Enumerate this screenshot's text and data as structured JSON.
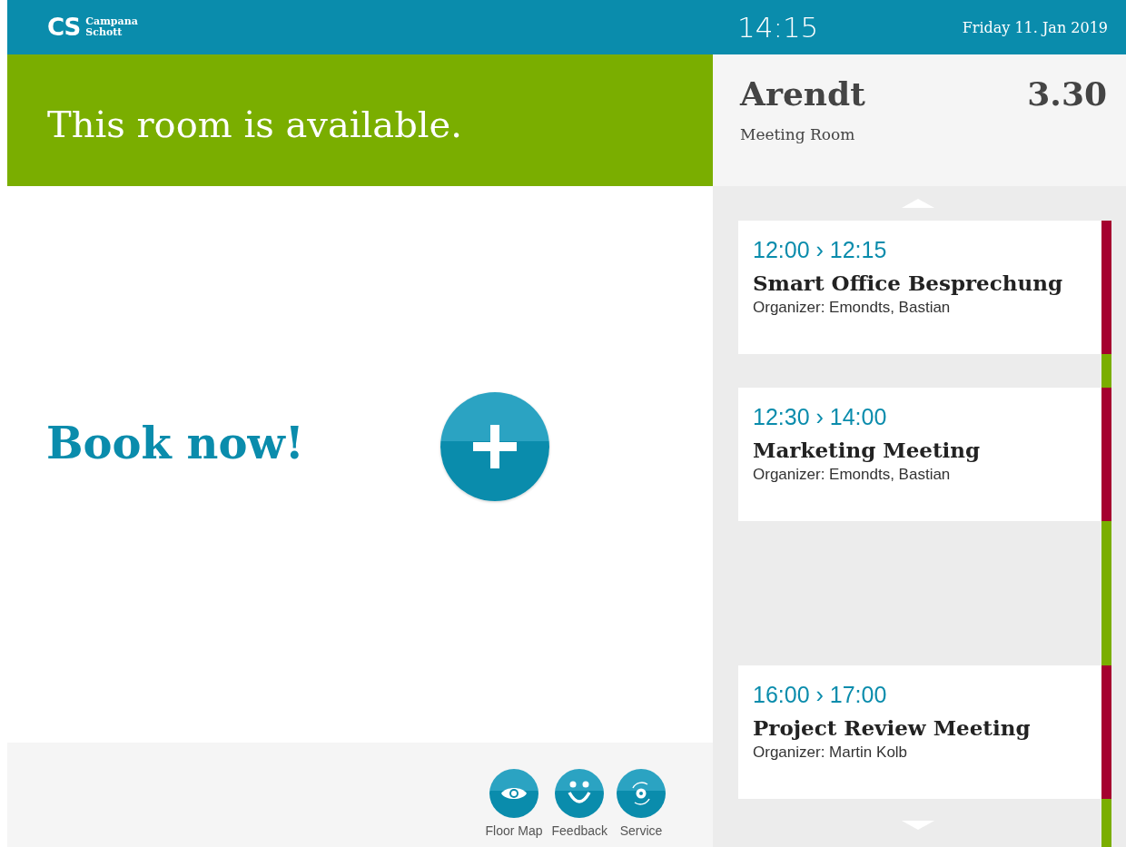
{
  "header": {
    "logo_mark": "CS",
    "logo_text": [
      "Campana",
      "Schott"
    ],
    "time": "14:15",
    "date": "Friday 11. Jan 2019"
  },
  "status": {
    "kind": "available",
    "message": "This room is available."
  },
  "booking": {
    "label": "Book now!"
  },
  "room": {
    "name": "Arendt",
    "number": "3.30",
    "type": "Meeting Room"
  },
  "schedule": [
    {
      "kind": "booking",
      "time": "12:00 › 12:15",
      "title": "Smart Office Besprechung",
      "organizer": "Organizer: Emondts, Bastian"
    },
    {
      "kind": "free",
      "long": false
    },
    {
      "kind": "booking",
      "time": "12:30 › 14:00",
      "title": "Marketing Meeting",
      "organizer": "Organizer: Emondts, Bastian"
    },
    {
      "kind": "free",
      "long": true
    },
    {
      "kind": "booking",
      "time": "16:00 › 17:00",
      "title": "Project Review Meeting",
      "organizer": "Organizer: Martin Kolb"
    },
    {
      "kind": "free"
    }
  ],
  "footer_actions": [
    {
      "kind": "eye",
      "label": "Floor Map"
    },
    {
      "kind": "smiley",
      "label": "Feedback"
    },
    {
      "kind": "service",
      "label": "Service"
    }
  ]
}
